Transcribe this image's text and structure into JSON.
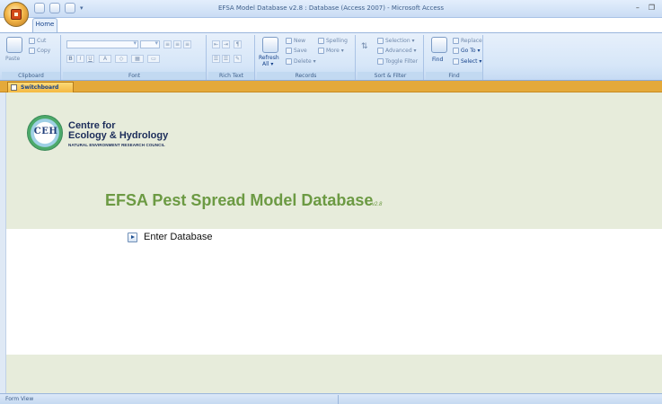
{
  "window": {
    "title": "EFSA Model Database v2.8 : Database (Access 2007) - Microsoft Access",
    "controls": {
      "minimize": "–",
      "restore": "❐"
    }
  },
  "ribbon": {
    "active_tab": "Home",
    "groups": {
      "clipboard": {
        "label": "Clipboard",
        "paste": "Paste",
        "cut": "Cut",
        "copy": "Copy"
      },
      "font": {
        "label": "Font"
      },
      "rich_text": {
        "label": "Rich Text"
      },
      "records": {
        "label": "Records",
        "refresh": "Refresh",
        "refresh_all": "All ▾",
        "new": "New",
        "save": "Save",
        "delete": "Delete ▾",
        "spelling": "Spelling",
        "more": "More ▾"
      },
      "sort_filter": {
        "label": "Sort & Filter",
        "selection": "Selection ▾",
        "advanced": "Advanced ▾",
        "toggle_filter": "Toggle Filter"
      },
      "find": {
        "label": "Find",
        "find": "Find",
        "replace": "Replace",
        "goto": "Go To ▾",
        "select": "Select ▾"
      }
    }
  },
  "document_tabs": [
    {
      "label": "Switchboard"
    }
  ],
  "form": {
    "org_line1": "Centre for",
    "org_line2": "Ecology & Hydrology",
    "org_sub": "NATURAL ENVIRONMENT RESEARCH COUNCIL",
    "logo_text": "CEH",
    "db_title": "EFSA Pest Spread Model Database",
    "db_version": "v2.8",
    "enter_label": "Enter Database"
  },
  "statusbar": {
    "text": "Form View"
  },
  "colors": {
    "accent_green": "#6c9a43",
    "tab_orange": "#e4a93a",
    "form_bg": "#e7ecdb"
  }
}
